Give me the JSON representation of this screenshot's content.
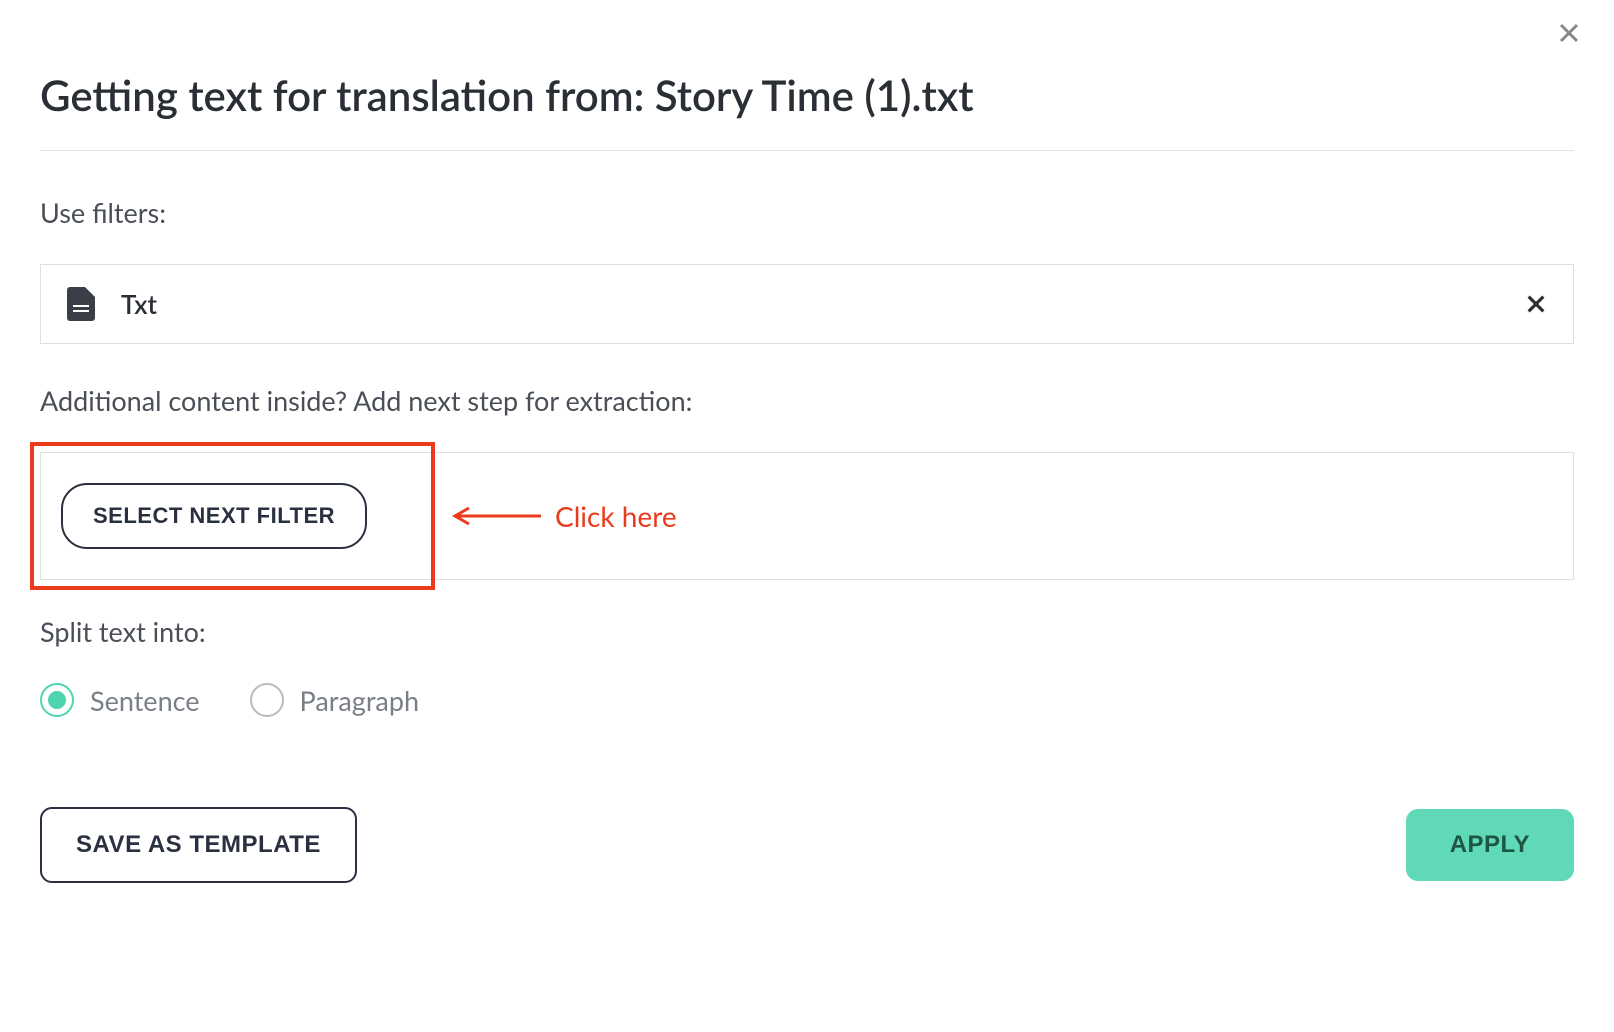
{
  "dialog": {
    "title": "Getting text for translation from: Story Time (1).txt"
  },
  "filters": {
    "label": "Use filters:",
    "items": [
      {
        "name": "Txt"
      }
    ]
  },
  "nextStep": {
    "label": "Additional content inside? Add next step for extraction:",
    "buttonLabel": "SELECT NEXT FILTER",
    "annotation": "Click here"
  },
  "split": {
    "label": "Split text into:",
    "options": [
      {
        "label": "Sentence",
        "selected": true
      },
      {
        "label": "Paragraph",
        "selected": false
      }
    ]
  },
  "footer": {
    "saveTemplate": "SAVE AS TEMPLATE",
    "apply": "APPLY"
  },
  "colors": {
    "accent": "#5fd9b8",
    "highlight": "#ea3b1c",
    "text": "#2a2f36"
  }
}
